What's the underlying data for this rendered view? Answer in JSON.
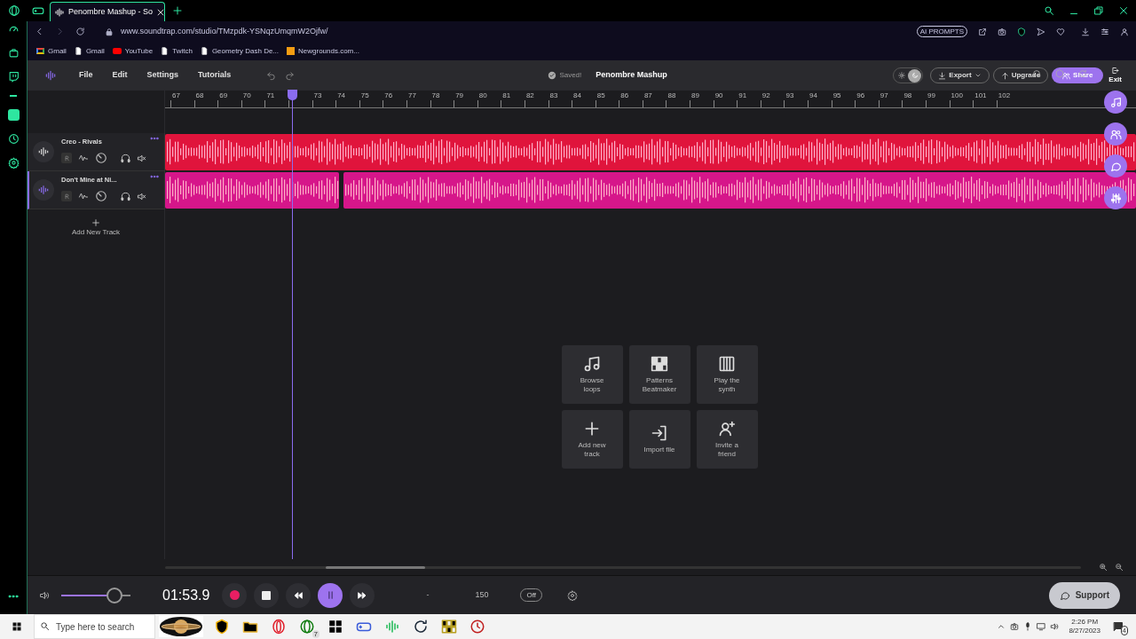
{
  "browser": {
    "tabs": [
      {
        "label": "Penombre Mashup - So",
        "selected": true
      }
    ],
    "url": "www.soundtrap.com/studio/TMzpdk-YSNqzUmqmW2Ojfw/",
    "ai_prompts": "AI PROMPTS",
    "bookmarks": [
      {
        "label": "Gmail",
        "kind": "gmail"
      },
      {
        "label": "Gmail",
        "kind": "page"
      },
      {
        "label": "YouTube",
        "kind": "youtube"
      },
      {
        "label": "Twitch",
        "kind": "page"
      },
      {
        "label": "Geometry Dash De...",
        "kind": "page"
      },
      {
        "label": "Newgrounds.com...",
        "kind": "ng"
      }
    ]
  },
  "studio": {
    "menu": [
      "File",
      "Edit",
      "Settings",
      "Tutorials"
    ],
    "saved": "Saved!",
    "project_title": "Penombre Mashup",
    "dark_mode": true,
    "export": "Export",
    "upgrade": "Upgrade",
    "share": "Share",
    "exit": "Exit"
  },
  "ruler": {
    "ticks": [
      {
        "label": "67"
      },
      {
        "label": "68"
      },
      {
        "label": "69"
      },
      {
        "label": "70"
      },
      {
        "label": "71"
      },
      {
        "covered": true
      },
      "73",
      "74",
      "75",
      "76",
      "77",
      "78",
      "79",
      "80",
      "81",
      "82",
      "83",
      "84",
      "85",
      "86",
      "87",
      "88",
      "89",
      "90",
      "91",
      "92",
      "93",
      "94",
      "95",
      "96",
      "97",
      "98",
      "99",
      "100",
      "101",
      "102"
    ]
  },
  "tracks": [
    {
      "name": "Creo - Rivals",
      "color": "#e0143c",
      "selected": false,
      "kind": "single"
    },
    {
      "name": "Don't Mine at Ni...",
      "color": "#d6168a",
      "selected": true,
      "kind": "split"
    }
  ],
  "add_track": "Add New Track",
  "tiles": [
    {
      "label": "Browse loops",
      "kind": "loops"
    },
    {
      "label": "Patterns Beatmaker",
      "kind": "patterns"
    },
    {
      "label": "Play the synth",
      "kind": "synth"
    },
    {
      "label": "Add new track",
      "kind": "add"
    },
    {
      "label": "Import file",
      "kind": "import"
    },
    {
      "label": "Invite a friend",
      "kind": "invite"
    }
  ],
  "transport": {
    "volume": {
      "level": 0.77
    },
    "time": "01:53.9",
    "playing": true,
    "key": "-",
    "tempo": "150",
    "metronome": "Off"
  },
  "support": "Support",
  "taskbar": {
    "search_placeholder": "Type here to search",
    "xbox_badge": "7",
    "time": "2:26 PM",
    "date": "8/27/2023",
    "notifications": "4"
  }
}
